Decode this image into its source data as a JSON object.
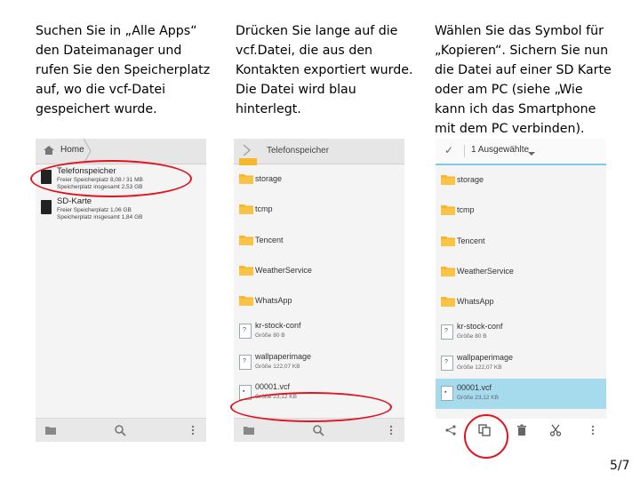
{
  "instructions": [
    {
      "lines": [
        "Suchen Sie in „Alle Apps“",
        "den Dateimanager und",
        "rufen Sie den Speicherplatz",
        "auf, wo die vcf-Datei",
        "gespeichert wurde."
      ]
    },
    {
      "lines": [
        "Drücken Sie lange auf die",
        "vcf.Datei, die aus den",
        "Kontakten exportiert wurde.",
        "Die Datei wird blau",
        "hinterlegt."
      ]
    },
    {
      "lines": [
        "Wählen Sie das Symbol für",
        "„Kopieren“. Sichern Sie nun",
        "die Datei auf einer SD Karte",
        "oder am PC (siehe „Wie",
        "kann ich das Smartphone",
        "mit dem PC verbinden)."
      ]
    }
  ],
  "screen1": {
    "breadcrumb": "Home",
    "storages": [
      {
        "name": "Telefonspeicher",
        "free": "Freier Speicherplatz 8,08 / 31 MB",
        "total": "Speicherplatz insgesamt 2,53 GB"
      },
      {
        "name": "SD-Karte",
        "free": "Freier Speicherplatz 1,06 GB",
        "total": "Speicherplatz insgesamt 1,84 GB"
      }
    ]
  },
  "screen2": {
    "breadcrumb": "Telefonspeicher",
    "items": [
      {
        "name": "storage"
      },
      {
        "name": "tcmp"
      },
      {
        "name": "Tencent"
      },
      {
        "name": "WeatherService"
      },
      {
        "name": "WhatsApp"
      },
      {
        "name": "kr-stock-conf",
        "size": "Größe 80 B"
      },
      {
        "name": "wallpaperimage",
        "size": "Größe 122,07 KB"
      },
      {
        "name": "00001.vcf",
        "size": "Größe 23,12 KB"
      }
    ]
  },
  "screen3": {
    "selection_label": "1 Ausgewählte",
    "items": [
      {
        "name": "storage"
      },
      {
        "name": "tcmp"
      },
      {
        "name": "Tencent"
      },
      {
        "name": "WeatherService"
      },
      {
        "name": "WhatsApp"
      },
      {
        "name": "kr-stock-conf",
        "size": "Größe 80 B"
      },
      {
        "name": "wallpaperimage",
        "size": "Größe 122,07 KB"
      },
      {
        "name": "00001.vcf",
        "size": "Größe 23,12 KB"
      }
    ]
  },
  "page_number": "5/7",
  "colors": {
    "highlight_circle": "#e0141e",
    "selected_row": "#a6dbee",
    "folder": "#f6b72b"
  }
}
